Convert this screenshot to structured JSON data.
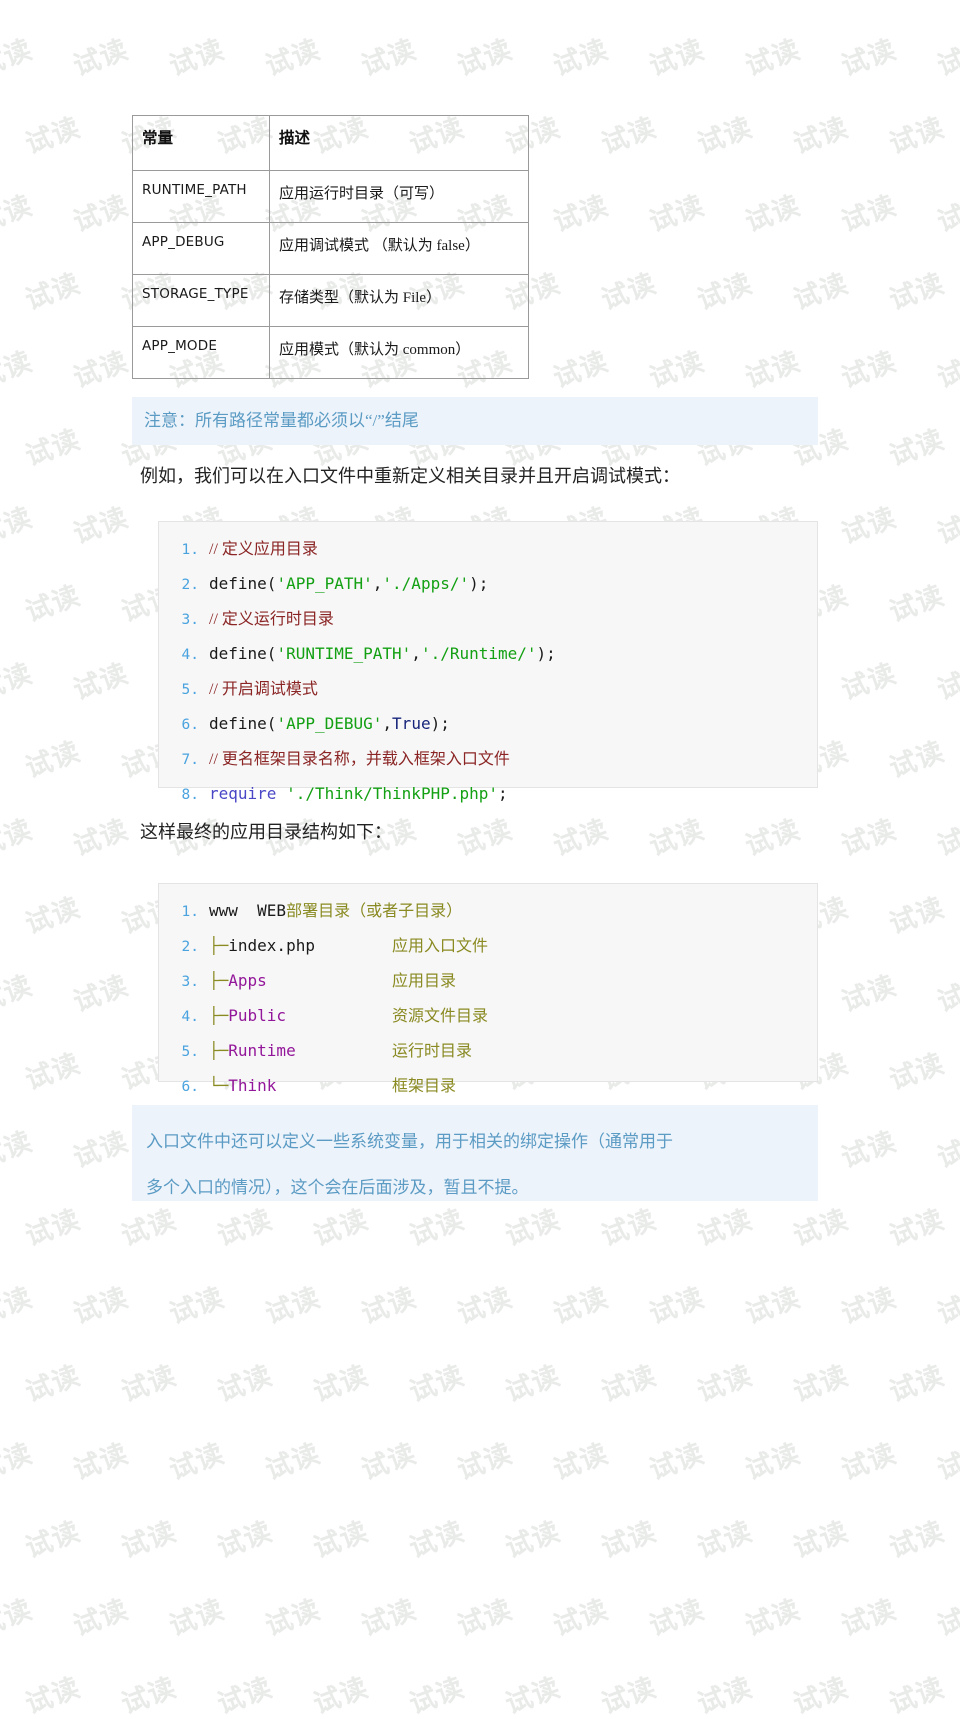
{
  "document": {
    "watermark_text": "试读"
  },
  "table": {
    "headers": [
      "常量",
      "描述"
    ],
    "rows": [
      {
        "constant": "RUNTIME_PATH",
        "description": "应用运行时目录（可写）"
      },
      {
        "constant": "APP_DEBUG",
        "description": "应用调试模式 （默认为 false）"
      },
      {
        "constant": "STORAGE_TYPE",
        "description": "存储类型（默认为 File）"
      },
      {
        "constant": "APP_MODE",
        "description": "应用模式（默认为 common）"
      }
    ]
  },
  "notes": {
    "top": "注意：所有路径常量都必须以“/”结尾",
    "bottom_line1": "入口文件中还可以定义一些系统变量，用于相关的绑定操作（通常用于",
    "bottom_line2": "多个入口的情况），这个会在后面涉及，暂且不提。"
  },
  "paragraphs": {
    "p1": "例如，我们可以在入口文件中重新定义相关目录并且开启调试模式：",
    "p2": "这样最终的应用目录结构如下："
  },
  "code_block_1": {
    "lines": [
      {
        "num": "1",
        "comment": "// 定义应用目录"
      },
      {
        "num": "2",
        "fn": "define(",
        "s1": "'APP_PATH'",
        "sep": ",",
        "s2": "'./Apps/'",
        "tail": ");"
      },
      {
        "num": "3",
        "comment": "// 定义运行时目录"
      },
      {
        "num": "4",
        "fn": "define(",
        "s1": "'RUNTIME_PATH'",
        "sep": ",",
        "s2": "'./Runtime/'",
        "tail": ");"
      },
      {
        "num": "5",
        "comment": "// 开启调试模式"
      },
      {
        "num": "6",
        "fn": "define(",
        "s1": "'APP_DEBUG'",
        "sep": ",",
        "const": "True",
        "tail": ");"
      },
      {
        "num": "7",
        "comment": "// 更名框架目录名称，并载入框架入口文件"
      },
      {
        "num": "8",
        "kw": "require",
        "s1": "'./Think/ThinkPHP.php'",
        "tail": ";"
      }
    ]
  },
  "code_block_2": {
    "lines": [
      {
        "num": "1",
        "tree": "",
        "name": "www  WEB",
        "name_color": "plain",
        "desc": "部署目录（或者子目录）"
      },
      {
        "num": "2",
        "tree": "├─",
        "name": "index.php",
        "name_color": "plain",
        "desc": "应用入口文件"
      },
      {
        "num": "3",
        "tree": "├─",
        "name": "Apps",
        "name_color": "purple",
        "desc": "应用目录"
      },
      {
        "num": "4",
        "tree": "├─",
        "name": "Public",
        "name_color": "purple",
        "desc": "资源文件目录"
      },
      {
        "num": "5",
        "tree": "├─",
        "name": "Runtime",
        "name_color": "purple",
        "desc": "运行时目录"
      },
      {
        "num": "6",
        "tree": "└─",
        "name": "Think",
        "name_color": "purple",
        "desc": "框架目录"
      }
    ]
  },
  "colors": {
    "note_background": "#edf3fa",
    "note_text": "#5b9bc4",
    "code_background": "#f7f7f7",
    "line_number": "#4aa3df",
    "comment": "#8b2525",
    "string": "#13a013",
    "keyword": "#4a47c6",
    "constant": "#16257b",
    "olive": "#8a8a22",
    "purple": "#93179a",
    "watermark": "#e9ebe9"
  }
}
